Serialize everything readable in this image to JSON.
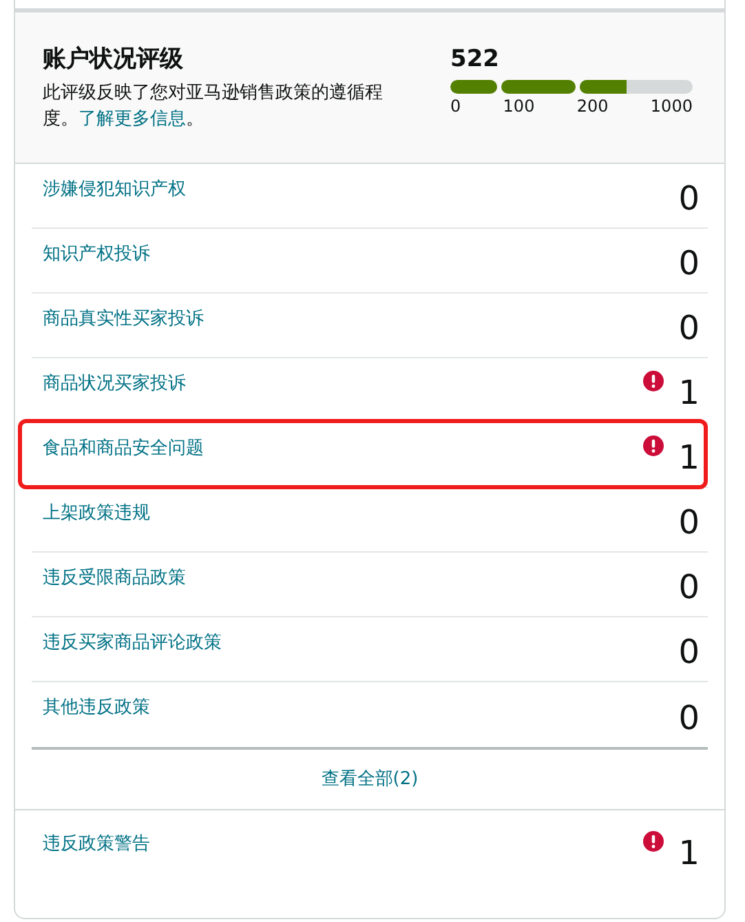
{
  "header": {
    "title": "账户状况评级",
    "description": "此评级反映了您对亚马逊销售政策的遵循程度。",
    "link": "了解更多信息",
    "link_suffix": "。",
    "score": "522",
    "segments": [
      {
        "level": 1
      },
      {
        "level": 1
      },
      {
        "level": 0.41
      }
    ],
    "ticks": [
      "0",
      "100",
      "200",
      "1000"
    ]
  },
  "rows": [
    {
      "label": "涉嫌侵犯知识产权",
      "count": "0",
      "alert": false,
      "highlighted": false
    },
    {
      "label": "知识产权投诉",
      "count": "0",
      "alert": false,
      "highlighted": false
    },
    {
      "label": "商品真实性买家投诉",
      "count": "0",
      "alert": false,
      "highlighted": false
    },
    {
      "label": "商品状况买家投诉",
      "count": "1",
      "alert": true,
      "highlighted": false
    },
    {
      "label": "食品和商品安全问题",
      "count": "1",
      "alert": true,
      "highlighted": true
    },
    {
      "label": "上架政策违规",
      "count": "0",
      "alert": false,
      "highlighted": false
    },
    {
      "label": "违反受限商品政策",
      "count": "0",
      "alert": false,
      "highlighted": false
    },
    {
      "label": "违反买家商品评论政策",
      "count": "0",
      "alert": false,
      "highlighted": false
    },
    {
      "label": "其他违反政策",
      "count": "0",
      "alert": false,
      "highlighted": false
    }
  ],
  "view_all": "查看全部(2)",
  "warning_row": {
    "label": "违反政策警告",
    "count": "1",
    "alert": true
  }
}
